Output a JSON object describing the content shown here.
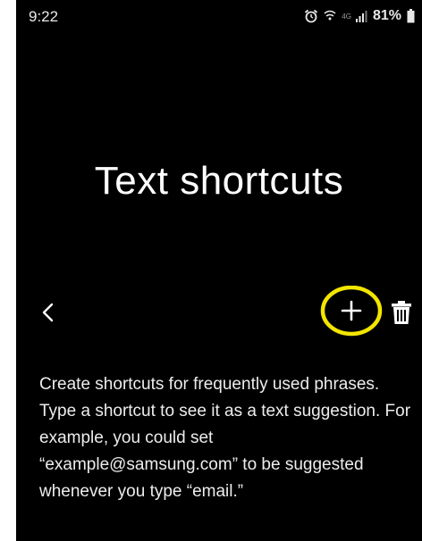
{
  "status_bar": {
    "time": "9:22",
    "network_label": "4G",
    "battery_percent": "81%",
    "icons": [
      "alarm-icon",
      "wifi-icon",
      "signal-icon",
      "battery-icon"
    ]
  },
  "header": {
    "title": "Text shortcuts"
  },
  "toolbar": {
    "back_icon": "chevron-left-icon",
    "add_icon": "plus-icon",
    "delete_icon": "trash-icon",
    "highlight_color": "#f2e600"
  },
  "main": {
    "description": "Create shortcuts for frequently used phrases. Type a shortcut to see it as a text suggestion. For example, you could set “example@samsung.com” to be suggested whenever you type “email.”"
  }
}
